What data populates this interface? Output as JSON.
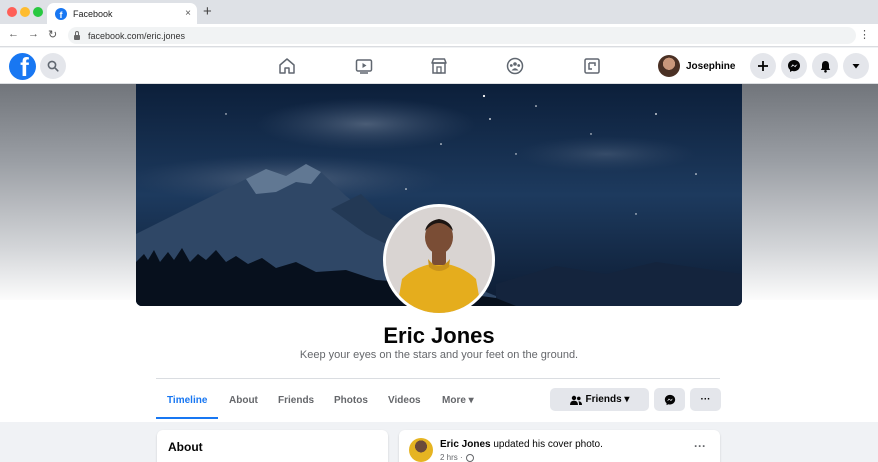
{
  "browser": {
    "tab_title": "Facebook",
    "tab_close": "×",
    "new_tab": "+",
    "url": "facebook.com/eric.jones",
    "nav_back": "←",
    "nav_forward": "→",
    "nav_reload": "↻",
    "menu": "⋮"
  },
  "header": {
    "logo_letter": "f",
    "user_name": "Josephine",
    "nav_icons": [
      "home-icon",
      "watch-icon",
      "marketplace-icon",
      "groups-icon",
      "gaming-icon"
    ],
    "right_icons": [
      "plus-icon",
      "messenger-icon",
      "bell-icon",
      "caret-down-icon"
    ]
  },
  "profile": {
    "name": "Eric Jones",
    "bio": "Keep your eyes on the stars and your feet on the ground."
  },
  "tabs": [
    {
      "label": "Timeline",
      "active": true
    },
    {
      "label": "About"
    },
    {
      "label": "Friends"
    },
    {
      "label": "Photos"
    },
    {
      "label": "Videos"
    },
    {
      "label": "More ▾"
    }
  ],
  "actions": {
    "friends_label": "Friends ▾",
    "more_label": "···"
  },
  "about": {
    "title": "About"
  },
  "post": {
    "author": "Eric Jones",
    "action": " updated his cover photo.",
    "time": "2 hrs ·",
    "more": "···"
  },
  "colors": {
    "brand": "#1877f2",
    "button_gray": "#e4e6eb",
    "secondary_text": "#65676b"
  }
}
